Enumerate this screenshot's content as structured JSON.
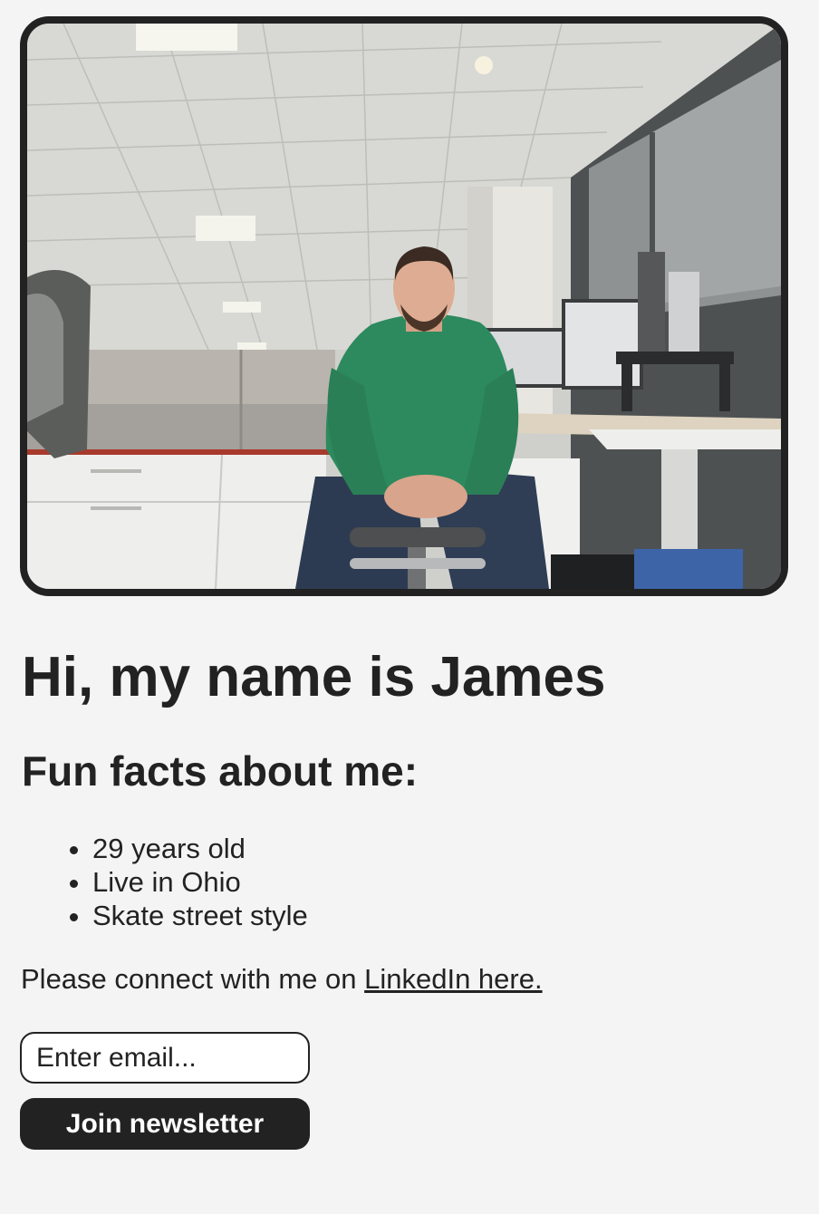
{
  "profile": {
    "photo_description": "photo-of-person",
    "greeting": "Hi, my name is James",
    "facts_heading": "Fun facts about me:",
    "facts": [
      "29 years old",
      "Live in Ohio",
      "Skate street style"
    ]
  },
  "connect": {
    "text": "Please connect with me on ",
    "link_label": "LinkedIn here."
  },
  "newsletter": {
    "email_placeholder": "Enter email...",
    "join_label": "Join newsletter"
  },
  "colors": {
    "background": "#f4f4f4",
    "text": "#222222",
    "button_bg": "#222222",
    "button_text": "#ffffff"
  }
}
